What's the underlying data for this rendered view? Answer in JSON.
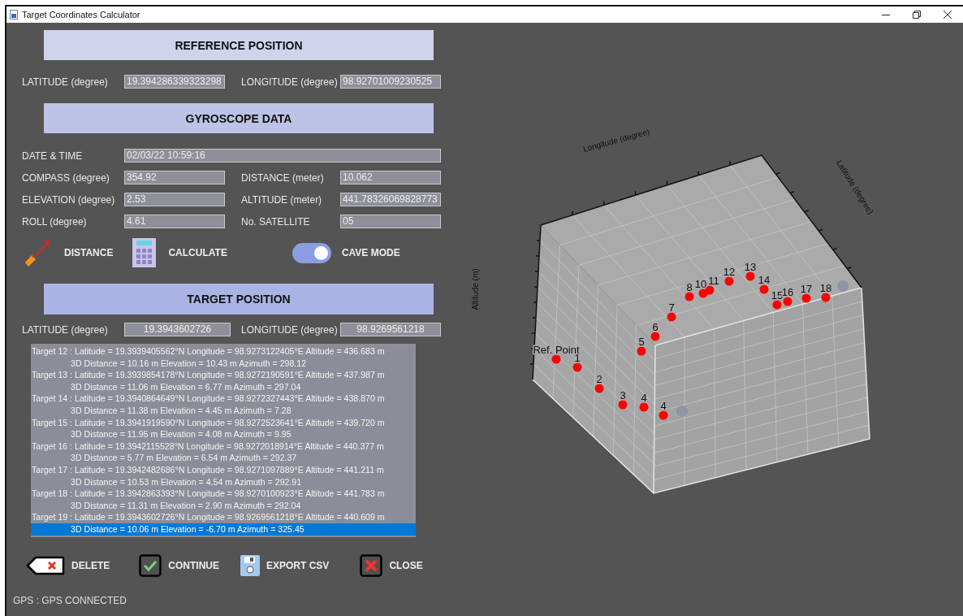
{
  "window": {
    "title": "Target Coordinates Calculator"
  },
  "reference_position": {
    "heading": "REFERENCE POSITION",
    "fields": [
      {
        "label": "LATITUDE (degree)",
        "value": "19.394286339323298"
      },
      {
        "label": "LONGITUDE (degree)",
        "value": "98.92701009230525"
      }
    ]
  },
  "gyroscope_data": {
    "heading": "GYROSCOPE DATA",
    "date_time": {
      "label": "DATE & TIME",
      "value": "02/03/22 10:59:16"
    },
    "fields": [
      {
        "label": "COMPASS (degree)",
        "value": "354.92"
      },
      {
        "label": "DISTANCE (meter)",
        "value": "10.062"
      },
      {
        "label": "ELEVATION (degree)",
        "value": "2.53"
      },
      {
        "label": "ALTITUDE (meter)",
        "value": "441.78326069828773"
      },
      {
        "label": "ROLL (degree)",
        "value": "4.61"
      },
      {
        "label": "No. SATELLITE",
        "value": "05"
      }
    ]
  },
  "tools": [
    {
      "kind": "distance",
      "label": "DISTANCE"
    },
    {
      "kind": "calculate",
      "label": "CALCULATE"
    },
    {
      "kind": "toggle",
      "label": "CAVE MODE",
      "on": true
    }
  ],
  "target_position": {
    "heading": "TARGET POSITION",
    "fields": [
      {
        "label": "LATITUDE (degree)",
        "value": "19.3943602726"
      },
      {
        "label": "LONGITUDE (degree)",
        "value": "98.9269561218"
      }
    ]
  },
  "results_list": [
    {
      "kind": "head",
      "text": "Target 12 : Latitude = 19.3939405562°N Longitude = 98.9273122405°E Altitude = 436.683 m",
      "selected": false
    },
    {
      "kind": "detail",
      "text": "3D Distance = 10.16 m Elevation = 10.43 m Azimuth = 298.12",
      "selected": false
    },
    {
      "kind": "head",
      "text": "Target 13 : Latitude = 19.3939854178°N Longitude = 98.9272190591°E Altitude = 437.987 m",
      "selected": false
    },
    {
      "kind": "detail",
      "text": "3D Distance = 11.06 m Elevation = 6.77 m Azimuth = 297.04",
      "selected": false
    },
    {
      "kind": "head",
      "text": "Target 14 : Latitude = 19.3940864649°N Longitude = 98.9272327443°E Altitude = 438.870 m",
      "selected": false
    },
    {
      "kind": "detail",
      "text": "3D Distance = 11.38 m Elevation = 4.45 m Azimuth = 7.28",
      "selected": false
    },
    {
      "kind": "head",
      "text": "Target 15 : Latitude = 19.3941919590°N Longitude = 98.9272523641°E Altitude = 439.720 m",
      "selected": false
    },
    {
      "kind": "detail",
      "text": "3D Distance = 11.95 m Elevation = 4.08 m Azimuth = 9.95",
      "selected": false
    },
    {
      "kind": "head",
      "text": "Target 16 : Latitude = 19.3942115528°N Longitude = 98.9272018914°E Altitude = 440.377 m",
      "selected": false
    },
    {
      "kind": "detail",
      "text": "3D Distance = 5.77 m Elevation = 6.54 m Azimuth = 292.37",
      "selected": false
    },
    {
      "kind": "head",
      "text": "Target 17 : Latitude = 19.3942482686°N Longitude = 98.9271097889°E Altitude = 441.211 m",
      "selected": false
    },
    {
      "kind": "detail",
      "text": "3D Distance = 10.53 m Elevation = 4.54 m Azimuth = 292.91",
      "selected": false
    },
    {
      "kind": "head",
      "text": "Target 18 : Latitude = 19.3942863393°N Longitude = 98.9270100923°E Altitude = 441.783 m",
      "selected": false
    },
    {
      "kind": "detail",
      "text": "3D Distance = 11.31 m Elevation = 2.90 m Azimuth = 292.04",
      "selected": false
    },
    {
      "kind": "head",
      "text": "Target 19 : Latitude = 19.3943602726°N Longitude = 98.9269561218°E Altitude = 440.609 m",
      "selected": false
    },
    {
      "kind": "detail",
      "text": "3D Distance = 10.06 m Elevation = -6.70 m Azimuth = 325.45",
      "selected": true
    }
  ],
  "buttons": [
    {
      "kind": "delete",
      "label": "DELETE"
    },
    {
      "kind": "continue",
      "label": "CONTINUE"
    },
    {
      "kind": "export",
      "label": "EXPORT CSV"
    },
    {
      "kind": "close",
      "label": "CLOSE"
    }
  ],
  "status_bar": "GPS : GPS CONNECTED",
  "plot": {
    "axis_labels": [
      {
        "kind": "longitude",
        "text": "Longitude (degree)"
      },
      {
        "kind": "latitude",
        "text": "Latitude (degree)"
      },
      {
        "kind": "altitude",
        "text": "Altitude (m)"
      }
    ],
    "points": [
      {
        "kind": "target",
        "label": "Ref. Point"
      },
      {
        "kind": "target",
        "label": "1"
      },
      {
        "kind": "target",
        "label": "2"
      },
      {
        "kind": "target",
        "label": "3"
      },
      {
        "kind": "target",
        "label": "4"
      },
      {
        "kind": "target",
        "label": "4"
      },
      {
        "kind": "target",
        "label": "5"
      },
      {
        "kind": "target",
        "label": "6"
      },
      {
        "kind": "target",
        "label": "7"
      },
      {
        "kind": "target",
        "label": "8"
      },
      {
        "kind": "target",
        "label": "10"
      },
      {
        "kind": "target",
        "label": "11"
      },
      {
        "kind": "target",
        "label": "12"
      },
      {
        "kind": "target",
        "label": "13"
      },
      {
        "kind": "target",
        "label": "14"
      },
      {
        "kind": "target",
        "label": "15"
      },
      {
        "kind": "target",
        "label": "16"
      },
      {
        "kind": "target",
        "label": "17"
      },
      {
        "kind": "target",
        "label": "18"
      },
      {
        "kind": "faded"
      },
      {
        "kind": "faded"
      }
    ]
  }
}
